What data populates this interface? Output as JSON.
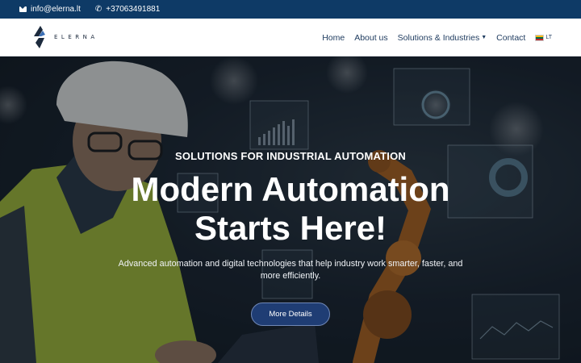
{
  "topbar": {
    "email": "info@elerna.lt",
    "phone": "+37063491881",
    "email_icon": "envelope-icon",
    "phone_icon": "phone-icon",
    "background": "#0e3a66"
  },
  "logo": {
    "wordmark": "ELERNA",
    "icon": "elerna-logo-mark"
  },
  "nav": {
    "home": "Home",
    "about": "About us",
    "solutions": "Solutions & Industries",
    "contact": "Contact",
    "language": "LT",
    "language_flag": "lithuania-flag-icon",
    "text_color": "#1d3a5e"
  },
  "hero": {
    "eyebrow": "SOLUTIONS FOR INDUSTRIAL AUTOMATION",
    "headline_line1": "Modern Automation",
    "headline_line2": "Starts Here!",
    "subtext": "Advanced automation and digital technologies that help industry work smarter, faster, and more efficiently.",
    "cta": "More Details",
    "cta_color": "#1f3d74"
  }
}
